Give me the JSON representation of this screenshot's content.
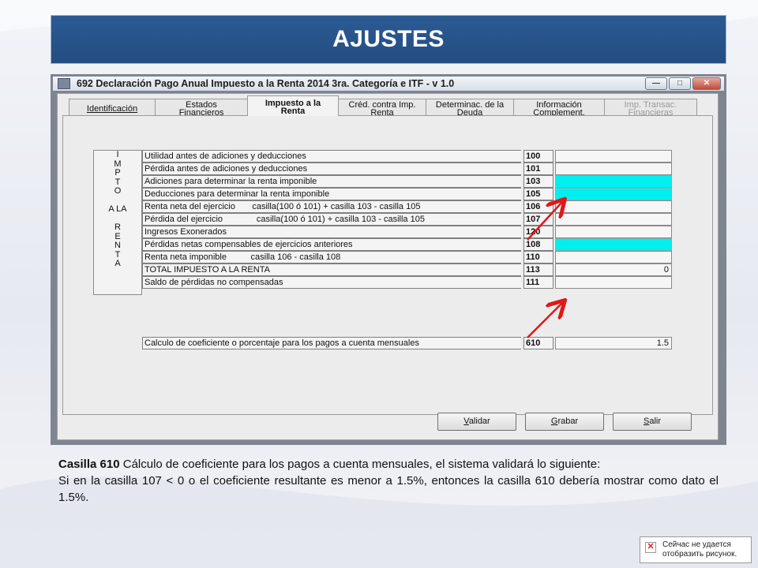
{
  "slide": {
    "title": "AJUSTES"
  },
  "window": {
    "title": "692 Declaración Pago Anual Impuesto a la Renta 2014 3ra. Categoría e ITF - v 1.0",
    "controls": {
      "minimize": "—",
      "maximize": "□",
      "close": "✕"
    }
  },
  "tabs": [
    {
      "line1": "Identificación",
      "line2": ""
    },
    {
      "line1": "Estados",
      "line2": "Financieros"
    },
    {
      "line1": "Impuesto a la",
      "line2": "Renta"
    },
    {
      "line1": "Créd. contra Imp.",
      "line2": "Renta"
    },
    {
      "line1": "Determinac. de la",
      "line2": "Deuda"
    },
    {
      "line1": "Información",
      "line2": "Complement."
    },
    {
      "line1": "Imp. Transac.",
      "line2": "Financieras"
    }
  ],
  "section_label": [
    "I",
    "M",
    "P",
    "T",
    "O",
    "",
    "A  LA",
    "",
    "R",
    "E",
    "N",
    "T",
    "A"
  ],
  "rows": [
    {
      "desc": "Utilidad antes de adiciones y deducciones",
      "code": "100",
      "value": ""
    },
    {
      "desc": "Pérdida antes de adiciones y deducciones",
      "code": "101",
      "value": ""
    },
    {
      "desc": "Adiciones para determinar la renta imponible",
      "code": "103",
      "value": ""
    },
    {
      "desc": "Deducciones para determinar la renta imponible",
      "code": "105",
      "value": ""
    },
    {
      "desc": "Renta neta del ejercicio       casilla(100 ó 101) + casilla 103 - casilla 105",
      "code": "106",
      "value": ""
    },
    {
      "desc": "Pérdida del ejercicio              casilla(100 ó 101) + casilla 103 - casilla 105",
      "code": "107",
      "value": ""
    },
    {
      "desc": "Ingresos Exonerados",
      "code": "120",
      "value": ""
    },
    {
      "desc": "Pérdidas netas compensables de ejercicios anteriores",
      "code": "108",
      "value": ""
    },
    {
      "desc": "Renta neta imponible          casilla 106 - casilla 108",
      "code": "110",
      "value": ""
    },
    {
      "desc": "TOTAL IMPUESTO A LA RENTA",
      "code": "113",
      "value": "0"
    },
    {
      "desc": "Saldo de pérdidas no compensadas",
      "code": "111",
      "value": ""
    }
  ],
  "row610": {
    "desc": "Calculo de coeficiente o porcentaje para los pagos a cuenta mensuales",
    "code": "610",
    "value": "1.5"
  },
  "buttons": {
    "validar": {
      "acc": "V",
      "rest": "alidar"
    },
    "grabar": {
      "acc": "G",
      "rest": "rabar"
    },
    "salir": {
      "acc": "S",
      "rest": "alir"
    }
  },
  "caption": {
    "bold": "Casilla 610",
    "line1": " Cálculo de coeficiente para los pagos a cuenta mensuales, el sistema validará lo siguiente:",
    "line2": "Si en la casilla 107 <  0    o el coeficiente resultante es menor a 1.5%, entonces la casilla 610 debería mostrar como dato el 1.5%."
  },
  "broken_image": {
    "line1": "Сейчас не удается",
    "line2": "отобразить рисунок."
  },
  "colors": {
    "title_bar": "#234d82",
    "cyan_field": "#00f0f0",
    "arrow": "#e01818"
  }
}
